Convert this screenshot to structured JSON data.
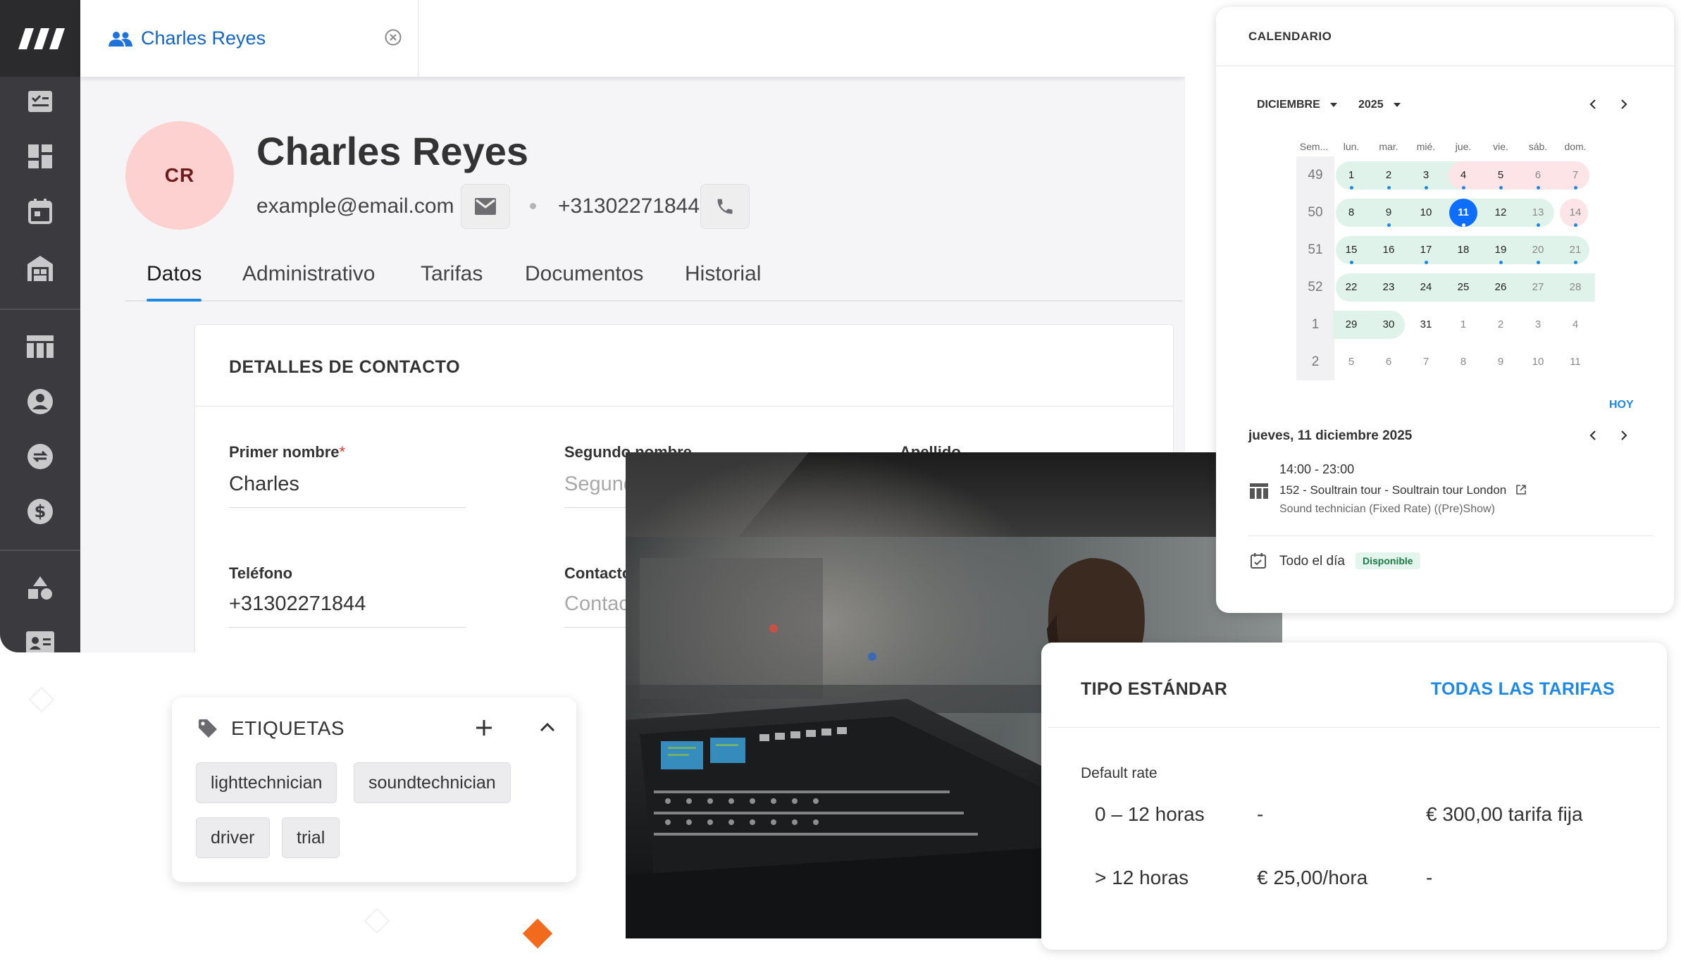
{
  "sidebar": {
    "logo": "brand-logo",
    "items": [
      "tasks-icon",
      "dashboard-icon",
      "calendar-icon",
      "warehouse-icon",
      "projects-table-icon",
      "user-icon",
      "sync-icon",
      "finance-icon",
      "shapes-icon",
      "crew-card-icon"
    ]
  },
  "tab": {
    "label": "Charles Reyes"
  },
  "profile": {
    "initials": "CR",
    "name": "Charles Reyes",
    "email": "example@email.com",
    "phone": "+31302271844"
  },
  "nav_tabs": [
    "Datos",
    "Administrativo",
    "Tarifas",
    "Documentos",
    "Historial"
  ],
  "contact": {
    "title": "DETALLES DE CONTACTO",
    "first_name_label": "Primer nombre",
    "first_name_value": "Charles",
    "second_name_label": "Segundo nombre",
    "second_name_placeholder": "Segundo",
    "last_name_label": "Apellido",
    "phone_label": "Teléfono",
    "phone_value": "+31302271844",
    "contact_label": "Contacto",
    "contact_placeholder": "Contacto"
  },
  "tags": {
    "title": "ETIQUETAS",
    "items": [
      "lighttechnician",
      "soundtechnician",
      "driver",
      "trial"
    ]
  },
  "calendar": {
    "title": "CALENDARIO",
    "month": "DICIEMBRE",
    "year": "2025",
    "day_headers": [
      "Sem...",
      "lun.",
      "mar.",
      "mié.",
      "jue.",
      "vie.",
      "sáb.",
      "dom."
    ],
    "weeks": [
      {
        "num": "49",
        "days": [
          "1",
          "2",
          "3",
          "4",
          "5",
          "6",
          "7"
        ]
      },
      {
        "num": "50",
        "days": [
          "8",
          "9",
          "10",
          "11",
          "12",
          "13",
          "14"
        ]
      },
      {
        "num": "51",
        "days": [
          "15",
          "16",
          "17",
          "18",
          "19",
          "20",
          "21"
        ]
      },
      {
        "num": "52",
        "days": [
          "22",
          "23",
          "24",
          "25",
          "26",
          "27",
          "28"
        ]
      },
      {
        "num": "1",
        "days": [
          "29",
          "30",
          "31",
          "1",
          "2",
          "3",
          "4"
        ]
      },
      {
        "num": "2",
        "days": [
          "5",
          "6",
          "7",
          "8",
          "9",
          "10",
          "11"
        ]
      }
    ],
    "today_button": "HOY",
    "selected_date": "jueves, 11 diciembre 2025",
    "event": {
      "time": "14:00 - 23:00",
      "title": "152 - Soultrain tour - Soultrain tour London",
      "subtitle": "Sound technician (Fixed Rate) ((Pre)Show)"
    },
    "all_day": "Todo el día",
    "availability": "Disponible",
    "colors": {
      "available": "#dff3ea",
      "unavailable": "#fde4e6",
      "today": "#0d6efd",
      "event_dot": "#1e88e5"
    }
  },
  "rates": {
    "title": "TIPO ESTÁNDAR",
    "link": "TODAS LAS TARIFAS",
    "subtitle": "Default rate",
    "rows": [
      {
        "range": "0 – 12 horas",
        "hourly": "-",
        "fixed": "€ 300,00 tarifa fija"
      },
      {
        "range": "> 12 horas",
        "hourly": "€ 25,00/hora",
        "fixed": "-"
      }
    ]
  }
}
